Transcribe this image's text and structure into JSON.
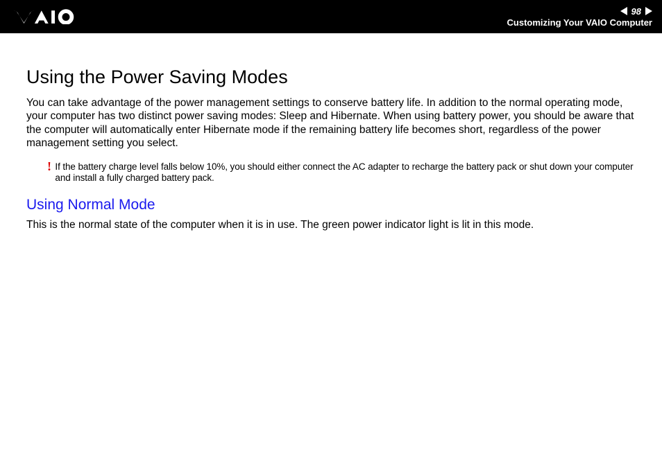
{
  "header": {
    "page_number": "98",
    "section": "Customizing Your VAIO Computer"
  },
  "content": {
    "title": "Using the Power Saving Modes",
    "intro": "You can take advantage of the power management settings to conserve battery life. In addition to the normal operating mode, your computer has two distinct power saving modes: Sleep and Hibernate. When using battery power, you should be aware that the computer will automatically enter Hibernate mode if the remaining battery life becomes short, regardless of the power management setting you select.",
    "warning": {
      "icon": "!",
      "text": "If the battery charge level falls below 10%, you should either connect the AC adapter to recharge the battery pack or shut down your computer and install a fully charged battery pack."
    },
    "subsection": {
      "title": "Using Normal Mode",
      "text": "This is the normal state of the computer when it is in use. The green power indicator light is lit in this mode."
    }
  }
}
